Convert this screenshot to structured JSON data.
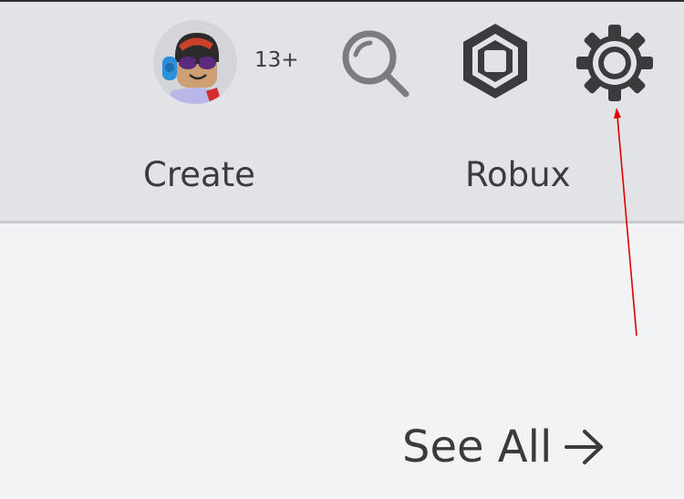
{
  "header": {
    "avatar": {
      "icon": "avatar-headshot"
    },
    "age_label": "13+",
    "search": {
      "icon": "search-icon"
    },
    "robux": {
      "icon": "robux-icon"
    },
    "settings": {
      "icon": "gear-icon"
    },
    "nav": [
      {
        "label": "Create"
      },
      {
        "label": "Robux"
      }
    ]
  },
  "main": {
    "see_all_label": "See All",
    "see_all_icon": "arrow-right-icon"
  },
  "annotation": {
    "color": "#e00000",
    "points_to": "settings"
  },
  "colors": {
    "topbar_bg": "#e1e3e6",
    "page_bg": "#f2f3f5",
    "text": "#393b3d",
    "icon": "#393b3d"
  }
}
